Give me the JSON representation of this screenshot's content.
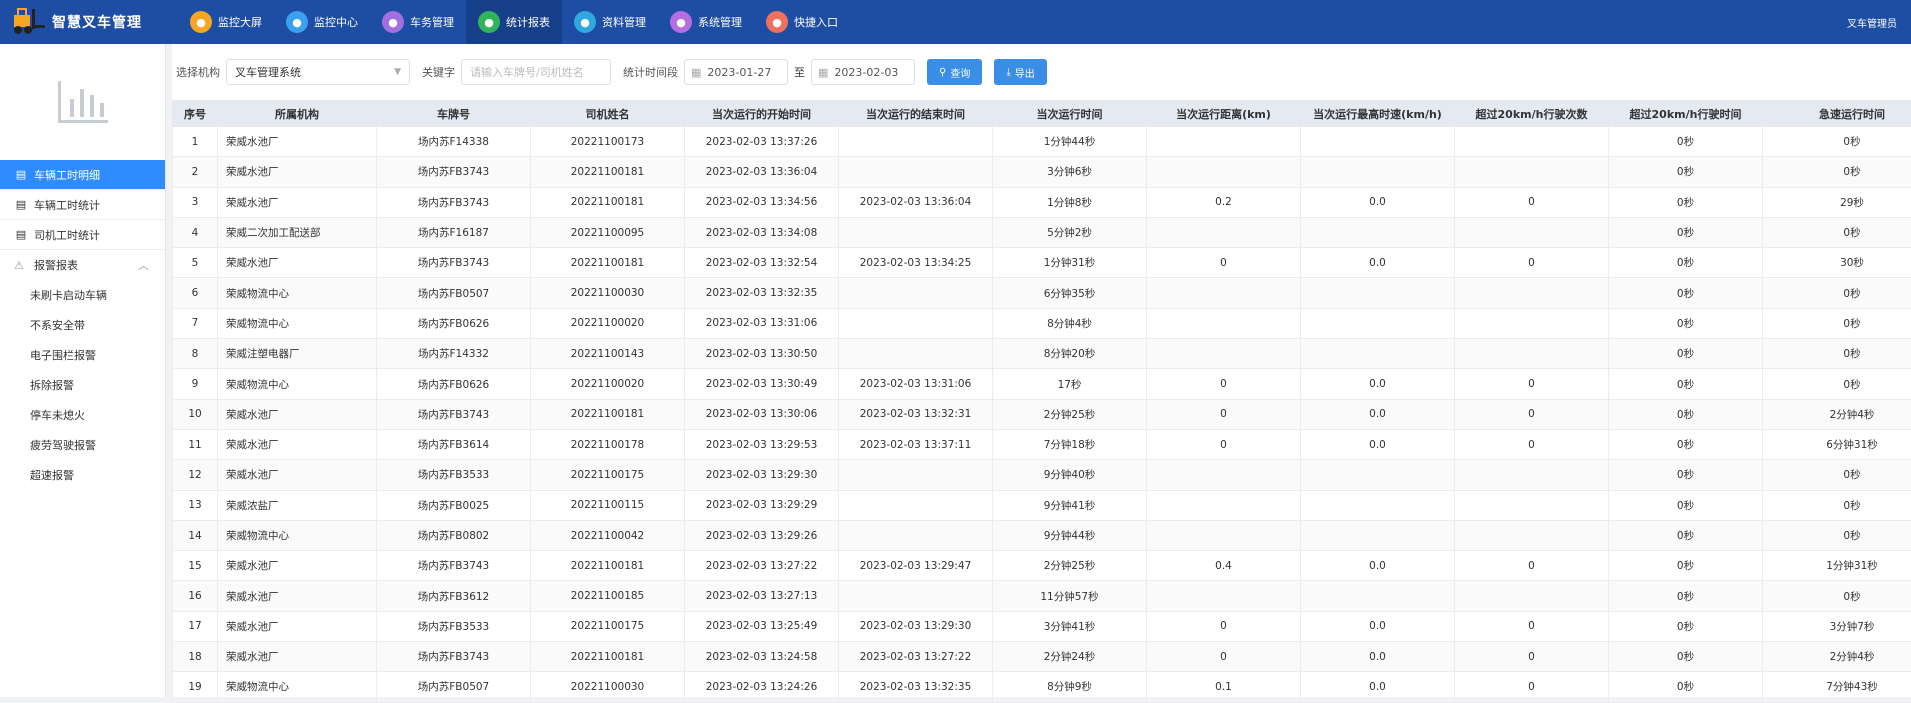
{
  "header": {
    "app_title": "智慧叉车管理",
    "user_label": "叉车管理员",
    "nav": [
      {
        "label": "监控大屏",
        "icon": "monitor-icon",
        "color": "#f5a623",
        "active": false
      },
      {
        "label": "监控中心",
        "icon": "location-icon",
        "color": "#3aa0f0",
        "active": false
      },
      {
        "label": "车务管理",
        "icon": "car-icon",
        "color": "#a36ee0",
        "active": false
      },
      {
        "label": "统计报表",
        "icon": "chart-icon",
        "color": "#2fb45a",
        "active": true
      },
      {
        "label": "资料管理",
        "icon": "document-icon",
        "color": "#2fa8e0",
        "active": false
      },
      {
        "label": "系统管理",
        "icon": "gear-icon",
        "color": "#b46ee0",
        "active": false
      },
      {
        "label": "快捷入口",
        "icon": "grid-icon",
        "color": "#f07060",
        "active": false
      }
    ]
  },
  "sidebar": {
    "items": [
      {
        "label": "车辆工时明细",
        "active": true
      },
      {
        "label": "车辆工时统计",
        "active": false
      },
      {
        "label": "司机工时统计",
        "active": false
      }
    ],
    "group": {
      "label": "报警报表",
      "children": [
        "未刷卡启动车辆",
        "不系安全带",
        "电子围栏报警",
        "拆除报警",
        "停车未熄火",
        "疲劳驾驶报警",
        "超速报警"
      ]
    }
  },
  "filter": {
    "org_label": "选择机构",
    "org_value": "叉车管理系统",
    "keyword_label": "关键字",
    "keyword_placeholder": "请输入车牌号/司机姓名",
    "period_label": "统计时间段",
    "date_from": "2023-01-27",
    "to_label": "至",
    "date_to": "2023-02-03",
    "query_label": "查询",
    "export_label": "导出"
  },
  "table": {
    "headers": [
      "序号",
      "所属机构",
      "车牌号",
      "司机姓名",
      "当次运行的开始时间",
      "当次运行的结束时间",
      "当次运行时间",
      "当次运行距离(km)",
      "当次运行最高时速(km/h)",
      "超过20km/h行驶次数",
      "超过20km/h行驶时间",
      "急速运行时间"
    ],
    "rows": [
      [
        "1",
        "荣威水池厂",
        "场内苏F14338",
        "20221100173",
        "2023-02-03 13:37:26",
        "",
        "1分钟44秒",
        "",
        "",
        "",
        "0秒",
        "0秒"
      ],
      [
        "2",
        "荣威水池厂",
        "场内苏FB3743",
        "20221100181",
        "2023-02-03 13:36:04",
        "",
        "3分钟6秒",
        "",
        "",
        "",
        "0秒",
        "0秒"
      ],
      [
        "3",
        "荣威水池厂",
        "场内苏FB3743",
        "20221100181",
        "2023-02-03 13:34:56",
        "2023-02-03 13:36:04",
        "1分钟8秒",
        "0.2",
        "0.0",
        "0",
        "0秒",
        "29秒"
      ],
      [
        "4",
        "荣威二次加工配送部",
        "场内苏F16187",
        "20221100095",
        "2023-02-03 13:34:08",
        "",
        "5分钟2秒",
        "",
        "",
        "",
        "0秒",
        "0秒"
      ],
      [
        "5",
        "荣威水池厂",
        "场内苏FB3743",
        "20221100181",
        "2023-02-03 13:32:54",
        "2023-02-03 13:34:25",
        "1分钟31秒",
        "0",
        "0.0",
        "0",
        "0秒",
        "30秒"
      ],
      [
        "6",
        "荣威物流中心",
        "场内苏FB0507",
        "20221100030",
        "2023-02-03 13:32:35",
        "",
        "6分钟35秒",
        "",
        "",
        "",
        "0秒",
        "0秒"
      ],
      [
        "7",
        "荣威物流中心",
        "场内苏FB0626",
        "20221100020",
        "2023-02-03 13:31:06",
        "",
        "8分钟4秒",
        "",
        "",
        "",
        "0秒",
        "0秒"
      ],
      [
        "8",
        "荣威注塑电器厂",
        "场内苏F14332",
        "20221100143",
        "2023-02-03 13:30:50",
        "",
        "8分钟20秒",
        "",
        "",
        "",
        "0秒",
        "0秒"
      ],
      [
        "9",
        "荣威物流中心",
        "场内苏FB0626",
        "20221100020",
        "2023-02-03 13:30:49",
        "2023-02-03 13:31:06",
        "17秒",
        "0",
        "0.0",
        "0",
        "0秒",
        "0秒"
      ],
      [
        "10",
        "荣威水池厂",
        "场内苏FB3743",
        "20221100181",
        "2023-02-03 13:30:06",
        "2023-02-03 13:32:31",
        "2分钟25秒",
        "0",
        "0.0",
        "0",
        "0秒",
        "2分钟4秒"
      ],
      [
        "11",
        "荣威水池厂",
        "场内苏FB3614",
        "20221100178",
        "2023-02-03 13:29:53",
        "2023-02-03 13:37:11",
        "7分钟18秒",
        "0",
        "0.0",
        "0",
        "0秒",
        "6分钟31秒"
      ],
      [
        "12",
        "荣威水池厂",
        "场内苏FB3533",
        "20221100175",
        "2023-02-03 13:29:30",
        "",
        "9分钟40秒",
        "",
        "",
        "",
        "0秒",
        "0秒"
      ],
      [
        "13",
        "荣威浓盐厂",
        "场内苏FB0025",
        "20221100115",
        "2023-02-03 13:29:29",
        "",
        "9分钟41秒",
        "",
        "",
        "",
        "0秒",
        "0秒"
      ],
      [
        "14",
        "荣威物流中心",
        "场内苏FB0802",
        "20221100042",
        "2023-02-03 13:29:26",
        "",
        "9分钟44秒",
        "",
        "",
        "",
        "0秒",
        "0秒"
      ],
      [
        "15",
        "荣威水池厂",
        "场内苏FB3743",
        "20221100181",
        "2023-02-03 13:27:22",
        "2023-02-03 13:29:47",
        "2分钟25秒",
        "0.4",
        "0.0",
        "0",
        "0秒",
        "1分钟31秒"
      ],
      [
        "16",
        "荣威水池厂",
        "场内苏FB3612",
        "20221100185",
        "2023-02-03 13:27:13",
        "",
        "11分钟57秒",
        "",
        "",
        "",
        "0秒",
        "0秒"
      ],
      [
        "17",
        "荣威水池厂",
        "场内苏FB3533",
        "20221100175",
        "2023-02-03 13:25:49",
        "2023-02-03 13:29:30",
        "3分钟41秒",
        "0",
        "0.0",
        "0",
        "0秒",
        "3分钟7秒"
      ],
      [
        "18",
        "荣威水池厂",
        "场内苏FB3743",
        "20221100181",
        "2023-02-03 13:24:58",
        "2023-02-03 13:27:22",
        "2分钟24秒",
        "0",
        "0.0",
        "0",
        "0秒",
        "2分钟4秒"
      ],
      [
        "19",
        "荣威物流中心",
        "场内苏FB0507",
        "20221100030",
        "2023-02-03 13:24:26",
        "2023-02-03 13:32:35",
        "8分钟9秒",
        "0.1",
        "0.0",
        "0",
        "0秒",
        "7分钟43秒"
      ]
    ]
  }
}
